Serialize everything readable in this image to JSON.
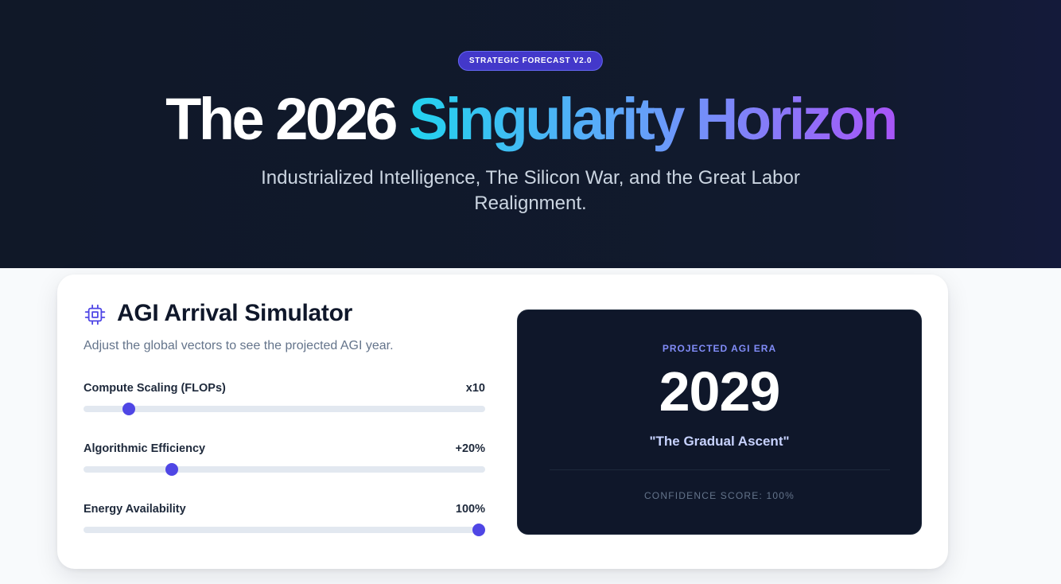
{
  "hero": {
    "badge": "STRATEGIC FORECAST V2.0",
    "title_plain": "The 2026 ",
    "title_highlight": "Singularity Horizon",
    "subtitle": "Industrialized Intelligence, The Silicon War, and the Great Labor Realignment."
  },
  "simulator": {
    "icon": "cpu-chip-icon",
    "title": "AGI Arrival Simulator",
    "description": "Adjust the global vectors to see the projected AGI year.",
    "sliders": [
      {
        "label": "Compute Scaling (FLOPs)",
        "value_text": "x10",
        "level": 0.1
      },
      {
        "label": "Algorithmic Efficiency",
        "value_text": "+20%",
        "level": 0.21
      },
      {
        "label": "Energy Availability",
        "value_text": "100%",
        "level": 1.0
      }
    ]
  },
  "result": {
    "label": "PROJECTED AGI ERA",
    "year": "2029",
    "era": "\"The Gradual Ascent\"",
    "confidence": "CONFIDENCE SCORE: 100%"
  },
  "colors": {
    "hero_bg": "#111827",
    "accent": "#4f46e5",
    "gradient_start": "#22d3ee",
    "gradient_end": "#a855f7",
    "result_bg": "#0f172a"
  }
}
